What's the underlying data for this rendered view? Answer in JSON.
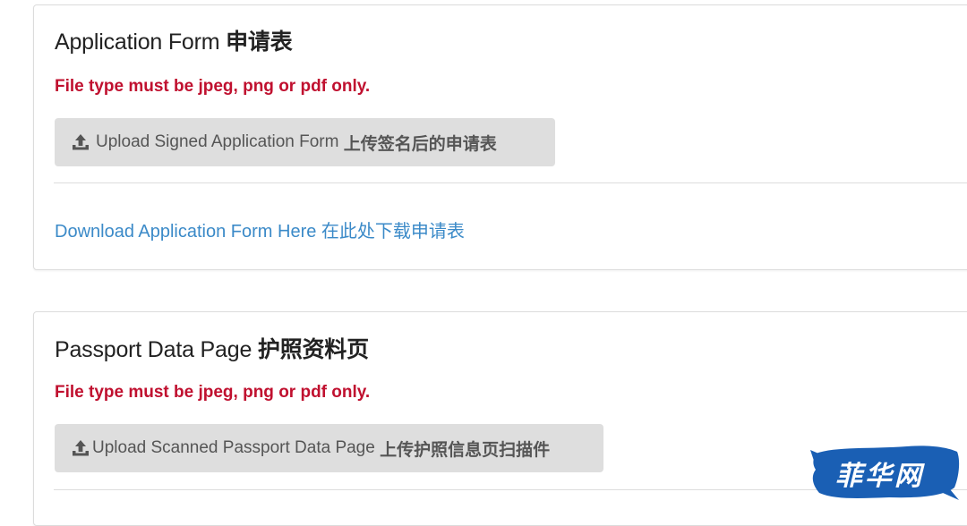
{
  "sections": [
    {
      "title": "Application Form",
      "title_cn": "申请表",
      "warning": "File type must be jpeg, png or pdf only.",
      "upload_button": {
        "icon": "upload-icon",
        "label": "Upload Signed Application Form",
        "label_cn": "上传签名后的申请表"
      },
      "download_link": "Download Application Form Here 在此处下载申请表"
    },
    {
      "title": "Passport Data Page",
      "title_cn": "护照资料页",
      "warning": "File type must be jpeg, png or pdf only.",
      "upload_button": {
        "icon": "upload-icon",
        "label": "Upload Scanned Passport Data Page",
        "label_cn": "上传护照信息页扫描件"
      }
    }
  ],
  "watermark": {
    "text": "菲华网",
    "color": "#1a5fb4"
  },
  "colors": {
    "warning": "#c0102f",
    "link": "#3b8ac8",
    "button_bg": "#dedede",
    "button_text": "#555555"
  }
}
